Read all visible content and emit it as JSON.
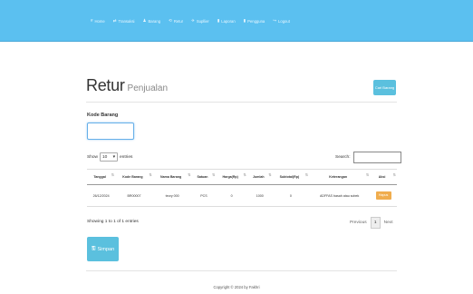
{
  "nav": {
    "items": [
      {
        "label": "Home",
        "icon": "#"
      },
      {
        "label": "Transaksi",
        "icon": "⇄"
      },
      {
        "label": "Barang",
        "icon": "♟"
      },
      {
        "label": "Retur",
        "icon": "⟲"
      },
      {
        "label": "Supllier",
        "icon": "✈"
      },
      {
        "label": "Laporan",
        "icon": "▮"
      },
      {
        "label": "Pengguna",
        "icon": "▮"
      },
      {
        "label": "Logout",
        "icon": "↪"
      }
    ],
    "bg_color": "#5bc0f0"
  },
  "page": {
    "title": "Retur",
    "subtitle": "Penjualan",
    "cari_barang_label": "Cari Barang"
  },
  "form": {
    "kode_label": "Kode Barang",
    "kode_value": ""
  },
  "table_controls": {
    "show_label": "Show",
    "page_size": "10",
    "entries_label": "entries",
    "search_label": "Search:",
    "search_value": ""
  },
  "table": {
    "headers": [
      "Tanggal",
      "Kode Barang",
      "Nama Barang",
      "Satuan",
      "Harga(Rp)",
      "Jumlah",
      "Subtotal(Rp)",
      "Keterangan",
      "Aksi"
    ],
    "rows": [
      {
        "tanggal": "26/12/2024",
        "kode": "BR00007",
        "nama": "teory 000",
        "satuan": "PCS",
        "harga": "0",
        "jumlah": "1000",
        "subtotal": "0",
        "keterangan": "ADFFAS basah atau sobek",
        "aksi": "Hapus"
      }
    ]
  },
  "pagination": {
    "info": "Showing 1 to 1 of 1 entries",
    "previous": "Previous",
    "current": "1",
    "next": "Next"
  },
  "actions": {
    "simpan_label": "Simpan"
  },
  "footer": {
    "text": "Copyright © 2024 by Fakhri"
  },
  "colors": {
    "info_button": "#5bc0de",
    "warning_button": "#f0ad4e"
  }
}
